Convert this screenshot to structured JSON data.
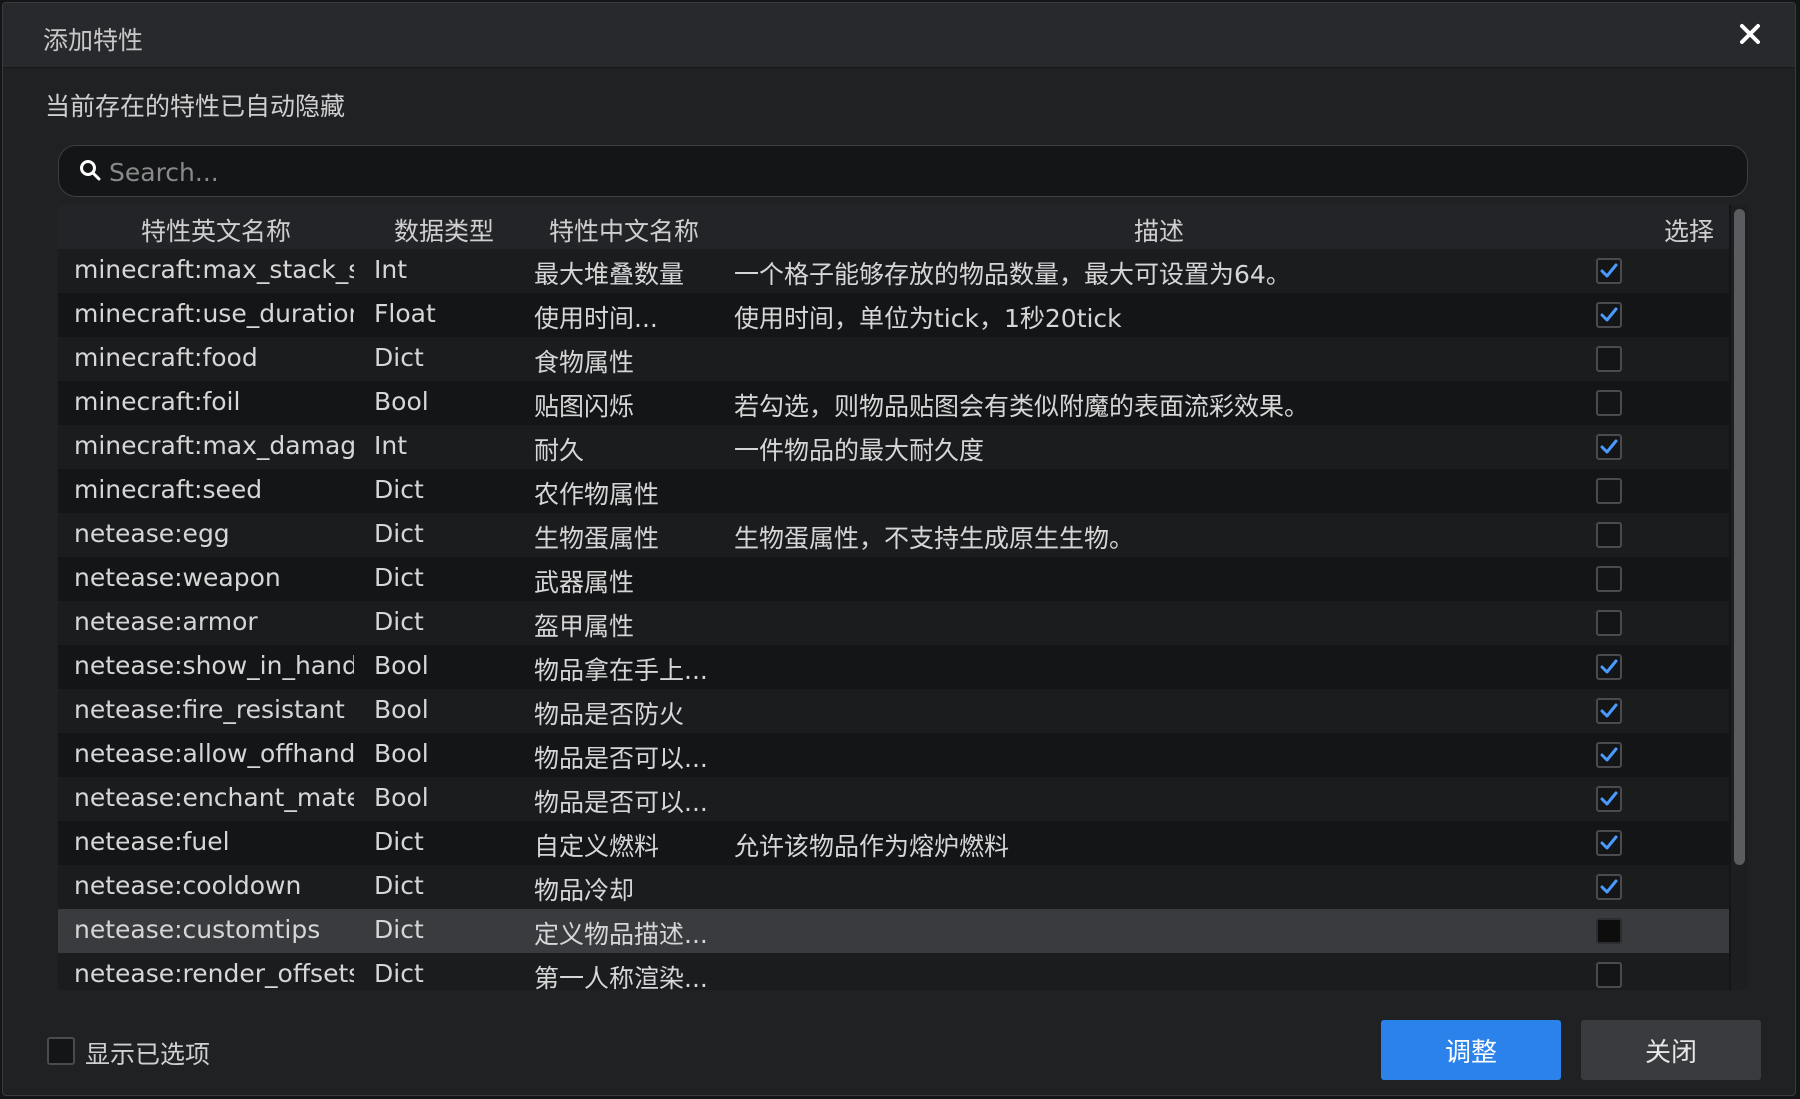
{
  "window": {
    "title": "添加特性",
    "close_icon": "close-icon"
  },
  "subtitle": "当前存在的特性已自动隐藏",
  "search": {
    "placeholder": "Search...",
    "value": "",
    "icon": "search-icon"
  },
  "table": {
    "columns": {
      "en_name": "特性英文名称",
      "type": "数据类型",
      "cn_name": "特性中文名称",
      "desc": "描述",
      "select": "选择"
    },
    "rows": [
      {
        "en": "minecraft:max_stack_s...",
        "type": "Int",
        "cn": "最大堆叠数量",
        "desc": "一个格子能够存放的物品数量，最大可设置为64。",
        "checked": true
      },
      {
        "en": "minecraft:use_duration",
        "type": "Float",
        "cn": "使用时间...",
        "desc": "使用时间，单位为tick，1秒20tick",
        "checked": true
      },
      {
        "en": "minecraft:food",
        "type": "Dict",
        "cn": "食物属性",
        "desc": "",
        "checked": false
      },
      {
        "en": "minecraft:foil",
        "type": "Bool",
        "cn": "贴图闪烁",
        "desc": "若勾选，则物品贴图会有类似附魔的表面流彩效果。",
        "checked": false
      },
      {
        "en": "minecraft:max_damage",
        "type": "Int",
        "cn": "耐久",
        "desc": "一件物品的最大耐久度",
        "checked": true
      },
      {
        "en": "minecraft:seed",
        "type": "Dict",
        "cn": "农作物属性",
        "desc": "",
        "checked": false
      },
      {
        "en": "netease:egg",
        "type": "Dict",
        "cn": "生物蛋属性",
        "desc": "生物蛋属性，不支持生成原生生物。",
        "checked": false
      },
      {
        "en": "netease:weapon",
        "type": "Dict",
        "cn": "武器属性",
        "desc": "",
        "checked": false
      },
      {
        "en": "netease:armor",
        "type": "Dict",
        "cn": "盔甲属性",
        "desc": "",
        "checked": false
      },
      {
        "en": "netease:show_in_hand",
        "type": "Bool",
        "cn": "物品拿在手上...",
        "desc": "",
        "checked": true
      },
      {
        "en": "netease:fire_resistant",
        "type": "Bool",
        "cn": "物品是否防火",
        "desc": "",
        "checked": true
      },
      {
        "en": "netease:allow_offhand",
        "type": "Bool",
        "cn": "物品是否可以...",
        "desc": "",
        "checked": true
      },
      {
        "en": "netease:enchant_mate...",
        "type": "Bool",
        "cn": "物品是否可以...",
        "desc": "",
        "checked": true
      },
      {
        "en": "netease:fuel",
        "type": "Dict",
        "cn": "自定义燃料",
        "desc": "允许该物品作为熔炉燃料",
        "checked": true
      },
      {
        "en": "netease:cooldown",
        "type": "Dict",
        "cn": "物品冷却",
        "desc": "",
        "checked": true
      },
      {
        "en": "netease:customtips",
        "type": "Dict",
        "cn": "定义物品描述...",
        "desc": "",
        "checked": false,
        "highlighted": true
      },
      {
        "en": "netease:render_offsets",
        "type": "Dict",
        "cn": "第一人称渲染...",
        "desc": "",
        "checked": false
      }
    ]
  },
  "footer": {
    "show_selected_label": "显示已选项",
    "show_selected_checked": false,
    "adjust_button": "调整",
    "close_button": "关闭"
  },
  "colors": {
    "accent": "#2b82ea",
    "check": "#4a9bff",
    "background": "#202123"
  }
}
